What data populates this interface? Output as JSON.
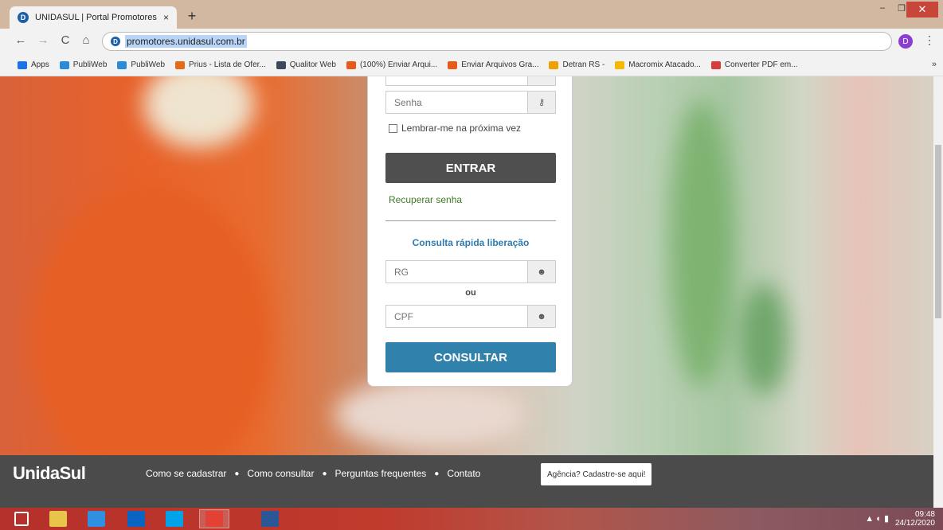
{
  "browser": {
    "tab_title": "UNIDASUL | Portal Promotores",
    "tab_close": "×",
    "new_tab": "+",
    "url": "promotores.unidasul.com.br",
    "profile_initial": "D",
    "window_controls": {
      "minimize": "–",
      "restore": "❐",
      "close": "✕"
    },
    "nav": {
      "back": "←",
      "forward": "→",
      "reload": "C",
      "home": "⌂"
    },
    "menu": "⋮",
    "bookmarks": [
      {
        "label": "Apps",
        "color": "#1a73e8"
      },
      {
        "label": "PubliWeb",
        "color": "#2a8bd8"
      },
      {
        "label": "PubliWeb",
        "color": "#2a8bd8"
      },
      {
        "label": "Prius - Lista de Ofer...",
        "color": "#e36b1a",
        "prefix": "US"
      },
      {
        "label": "Qualitor Web",
        "color": "#3a4a5a"
      },
      {
        "label": "(100%) Enviar Arqui...",
        "color": "#e85a1a"
      },
      {
        "label": "Enviar Arquivos Gra...",
        "color": "#e85a1a"
      },
      {
        "label": "Detran RS -",
        "color": "#f0a000"
      },
      {
        "label": "Macromix Atacado...",
        "color": "#f5b800"
      },
      {
        "label": "Converter PDF em...",
        "color": "#d83b3b"
      }
    ],
    "bookmarks_more": "»"
  },
  "login": {
    "senha_placeholder": "Senha",
    "remember_label": "Lembrar-me na próxima vez",
    "enter_button": "ENTRAR",
    "recover_link": "Recuperar senha",
    "quick_title": "Consulta rápida liberação",
    "rg_placeholder": "RG",
    "or_label": "ou",
    "cpf_placeholder": "CPF",
    "consult_button": "CONSULTAR"
  },
  "footer": {
    "logo": "UnidaSul",
    "links": [
      "Como se cadastrar",
      "Como consultar",
      "Perguntas frequentes",
      "Contato"
    ],
    "separator": "●",
    "agency_button": "Agência? Cadastre-se aqui!"
  },
  "taskbar": {
    "time": "09:48",
    "date": "24/12/2020",
    "apps": [
      {
        "name": "start",
        "color": "#ffffff"
      },
      {
        "name": "file-explorer",
        "color": "#e9c44a"
      },
      {
        "name": "internet-explorer",
        "color": "#2f8fe0"
      },
      {
        "name": "outlook",
        "color": "#0a64c2"
      },
      {
        "name": "skype",
        "color": "#00a2e8"
      },
      {
        "name": "chrome",
        "color": "#e34133"
      },
      {
        "name": "word",
        "color": "#2b5797"
      }
    ]
  }
}
